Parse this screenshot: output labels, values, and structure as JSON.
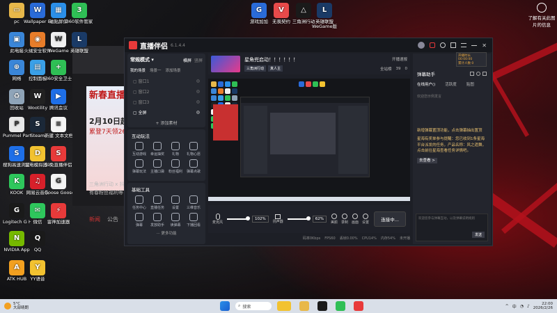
{
  "desktop": {
    "icons": [
      {
        "label": "pc",
        "color": "#e8b84a",
        "glyph": "▭"
      },
      {
        "label": "Wallpaper Engine:...",
        "color": "#2a6bd8",
        "glyph": "W"
      },
      {
        "label": "磁贴屏保",
        "color": "#2b8fe8",
        "glyph": "▦"
      },
      {
        "label": "360软件管家",
        "color": "#2fbf55",
        "glyph": "3"
      },
      {
        "label": "此电脑",
        "color": "#3a86d8",
        "glyph": "▣"
      },
      {
        "label": "火绒安全软件",
        "color": "#e87d2a",
        "glyph": "◉"
      },
      {
        "label": "WeGame",
        "color": "#f0f0f0",
        "glyph": "W"
      },
      {
        "label": "英雄联盟",
        "color": "#1a3a66",
        "glyph": "L"
      },
      {
        "label": "网络",
        "color": "#3a86d8",
        "glyph": "⊕"
      },
      {
        "label": "控制面板",
        "color": "#3aa0e8",
        "glyph": "▤"
      },
      {
        "label": "360安全卫士",
        "color": "#2fbf55",
        "glyph": "+"
      },
      {
        "label": "回收站",
        "color": "#8fa4b8",
        "glyph": "♻"
      },
      {
        "label": "Wootility",
        "color": "#222",
        "glyph": "W"
      },
      {
        "label": "腾讯会议",
        "color": "#1e6fe8",
        "glyph": "▶"
      },
      {
        "label": "Pummel Party",
        "color": "#e8e8e8",
        "glyph": "P"
      },
      {
        "label": "Steam",
        "color": "#1b2838",
        "glyph": "S"
      },
      {
        "label": "新建 文本文档 (2)",
        "color": "#f4f4f4",
        "glyph": "≡"
      },
      {
        "label": "搜狗高速浏览器",
        "color": "#1e6fe8",
        "glyph": "S"
      },
      {
        "label": "雷电模拟器9",
        "color": "#f2c230",
        "glyph": "D"
      },
      {
        "label": "S-免直播伴侣",
        "color": "#e83a3a",
        "glyph": "S"
      },
      {
        "label": "KOOK",
        "color": "#2ec75c",
        "glyph": "K"
      },
      {
        "label": "网易云音乐",
        "color": "#d8202a",
        "glyph": "♫"
      },
      {
        "label": "Goose Goose Duck",
        "color": "#f4f4f4",
        "glyph": "G"
      },
      {
        "label": "Logitech G HUB",
        "color": "#1a1a1a",
        "glyph": "G"
      },
      {
        "label": "微信",
        "color": "#2ec75c",
        "glyph": "✉"
      },
      {
        "label": "雷神加速器",
        "color": "#e83a3a",
        "glyph": "⚡"
      },
      {
        "label": "NVIDIA App",
        "color": "#76b900",
        "glyph": "N"
      },
      {
        "label": "QQ",
        "color": "#1a1a1a",
        "glyph": "Q"
      },
      {
        "label": "ATK HUB",
        "color": "#f2a020",
        "glyph": "A"
      },
      {
        "label": "YY语音",
        "color": "#f2c230",
        "glyph": "Y"
      }
    ],
    "top_icons": [
      {
        "label": "游戏加加",
        "color": "#2a6bd8",
        "glyph": "G"
      },
      {
        "label": "无畏契约",
        "color": "#e84a4a",
        "glyph": "V"
      },
      {
        "label": "三角洲行动",
        "color": "#1a1a1a",
        "glyph": "△"
      },
      {
        "label": "英雄联盟WeGame版",
        "color": "#1a3a66",
        "glyph": "L"
      }
    ],
    "right_widget": "了解有关此图片的信息"
  },
  "app": {
    "logo_text": "直播伴侣",
    "version": "6.1.4.4",
    "mode_label": "常规模式",
    "orient_horizontal": "横屏",
    "orient_vertical": "竖屏",
    "scene_tabs": [
      "我的场景",
      "场景一",
      "添加场景"
    ],
    "sources": [
      "窗口1",
      "窗口2",
      "窗口3",
      "全屏"
    ],
    "add_material": "添加素材",
    "interact_title": "互动玩法",
    "interact_items": [
      "互动游戏",
      "幸运抽奖",
      "礼物",
      "礼物心愿",
      "弹幕玩法",
      "主播口袋",
      "粉丝福利",
      "弹幕点歌"
    ],
    "basic_title": "基础工具",
    "basic_items": [
      "任务中心",
      "直播任务",
      "设置",
      "三维音乐",
      "弹幕",
      "发放助手",
      "读弹幕",
      "下播回看"
    ],
    "more_functions": "更多功能",
    "stream_title": "星角兜启动！！！！！！",
    "stream_tags": [
      "三角洲行动",
      "真人主"
    ],
    "header_actions": [
      "开播速报",
      "全站榜",
      "39",
      "0"
    ],
    "right_tab_title": "弹幕助手",
    "right_tabs": [
      "在线用户()",
      "活跃度",
      "贴图"
    ],
    "right_placeholder": "欢迎您示例发言",
    "sys_messages": [
      "新增弹幕置顶功能，点击弹幕抽出置顶",
      "星海有奖单参与提醒：您已收到1条星海平台派发的任务，产品名称：风之遗舞，点击前往星海查看任务详情吧。"
    ],
    "go_view": "去查看 >",
    "input_hint": "欢迎您参与弹幕互动，以及弹幕说明规则",
    "send_label": "发送",
    "notify": [
      "开播时长 00:00:00",
      "累计人数 0"
    ],
    "mic_label": "麦克风",
    "mic_volume": "102%",
    "speaker_label": "扬声器",
    "speaker_volume": "62%",
    "bottom_actions": [
      "美颜",
      "录制",
      "画面",
      "设置"
    ],
    "go_live": "连接中...",
    "status_items": [
      "码率0Kbps",
      "FPS60",
      "丢帧0.00%",
      "CPU14%",
      "内存54%",
      "未开播"
    ]
  },
  "bg_banner": {
    "title": "新春直播福利",
    "date": "2月10日起",
    "sub": "累登7天领26",
    "tab": "新闻",
    "tab2": "公告",
    "line": "三角洲行动 x 抖",
    "line2": "有春粉丝福利等"
  },
  "taskbar": {
    "weather": "5°C",
    "weather_sub": "大部晴朗",
    "search_placeholder": "搜索",
    "time": "22:00",
    "date": "2026/2/26",
    "lang": "中"
  }
}
